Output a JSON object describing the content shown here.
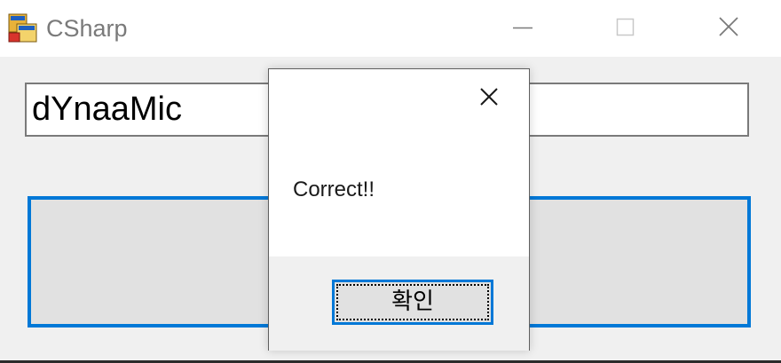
{
  "window": {
    "title": "CSharp",
    "icon": "application-icon",
    "controls": [
      "minimize-icon",
      "maximize-icon",
      "close-icon"
    ]
  },
  "form": {
    "textbox_value": "dYnaaMic",
    "button_label": ""
  },
  "message_box": {
    "text": "Correct!!",
    "ok_label": "확인",
    "close_icon": "close-icon"
  },
  "colors": {
    "accent": "#0078d7",
    "background": "#f0f0f0",
    "title_text": "#7a7a7a"
  }
}
